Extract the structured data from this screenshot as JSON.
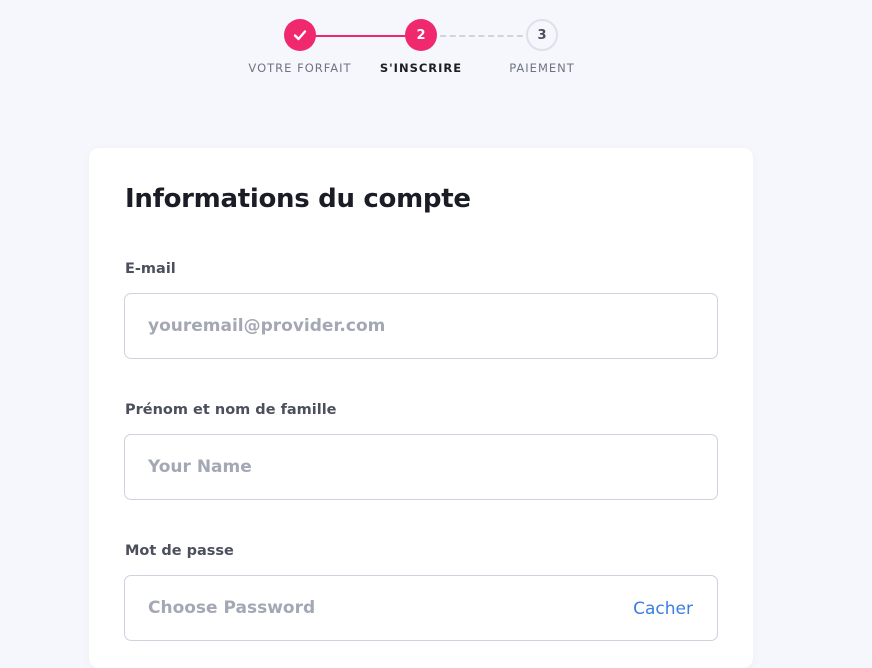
{
  "stepper": {
    "steps": [
      {
        "number": "",
        "label": "VOTRE FORFAIT",
        "state": "done",
        "icon": "check-icon"
      },
      {
        "number": "2",
        "label": "S'INSCRIRE",
        "state": "active"
      },
      {
        "number": "3",
        "label": "PAIEMENT",
        "state": "todo"
      }
    ]
  },
  "colors": {
    "accent": "#f0296f",
    "link": "#3a7ee0",
    "background": "#f6f7fc"
  },
  "form": {
    "title": "Informations du compte",
    "email": {
      "label": "E-mail",
      "placeholder": "youremail@provider.com",
      "value": ""
    },
    "name": {
      "label": "Prénom et nom de famille",
      "placeholder": "Your Name",
      "value": ""
    },
    "password": {
      "label": "Mot de passe",
      "placeholder": "Choose Password",
      "value": "",
      "toggle_label": "Cacher"
    }
  }
}
